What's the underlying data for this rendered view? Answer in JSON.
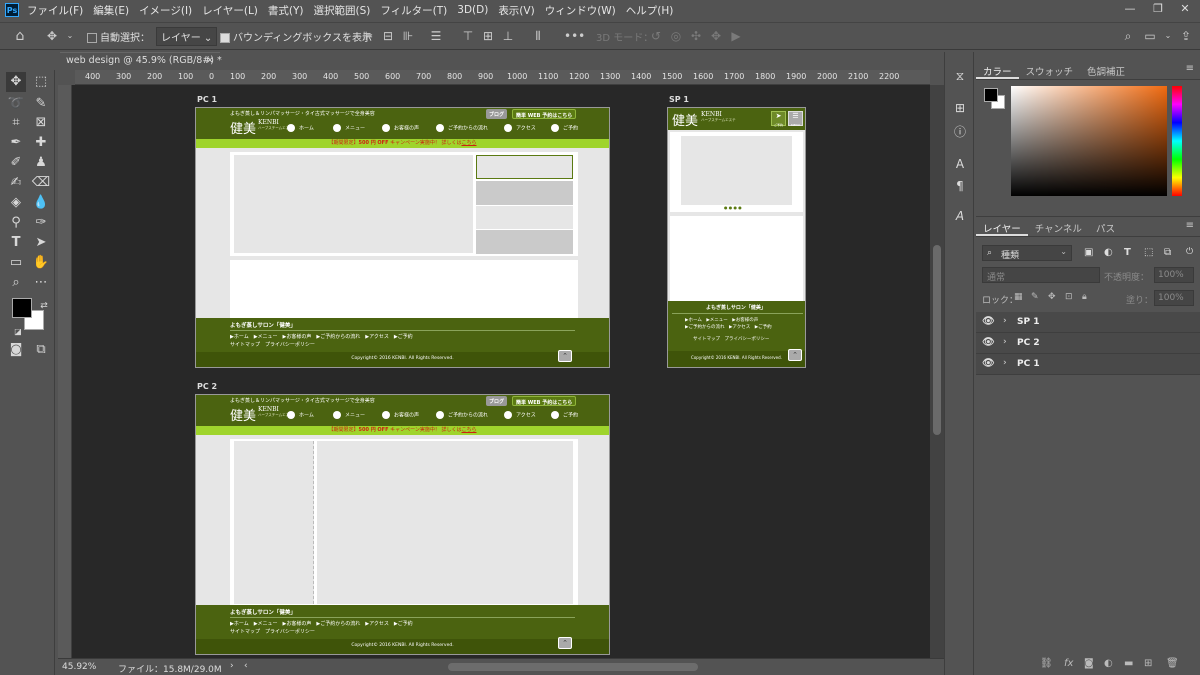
{
  "menubar": {
    "items": [
      "ファイル(F)",
      "編集(E)",
      "イメージ(I)",
      "レイヤー(L)",
      "書式(Y)",
      "選択範囲(S)",
      "フィルター(T)",
      "3D(D)",
      "表示(V)",
      "ウィンドウ(W)",
      "ヘルプ(H)"
    ],
    "ps_logo": "Ps"
  },
  "options": {
    "auto_select": "自動選択：",
    "layer_dropdown": "レイヤー",
    "bounding_box": "バウンディングボックスを表示",
    "mode3d": "3D モード："
  },
  "doc": {
    "tab_title": "web design @ 45.9% (RGB/8#) *",
    "close": "×",
    "zoom": "45.92%",
    "file_info": "ファイル：15.8M/29.0M"
  },
  "ruler": {
    "h_labels": [
      "400",
      "300",
      "200",
      "100",
      "0",
      "100",
      "200",
      "300",
      "400",
      "500",
      "600",
      "700",
      "800",
      "900",
      "1000",
      "1100",
      "1200",
      "1300",
      "1400",
      "1500",
      "1600",
      "1700",
      "1800",
      "1900",
      "2000",
      "2100",
      "2200"
    ]
  },
  "artboards": {
    "pc1_label": "PC 1",
    "pc2_label": "PC 2",
    "sp1_label": "SP 1",
    "tagline": "よもぎ蒸し＆リンパマッサージ・タイ古式マッサージで全身美容",
    "logo_jp": "健美",
    "logo_en": "KENBI",
    "logo_sub": "ハーブスチームエステ",
    "blog_btn": "ブログ",
    "reserve_btn": "簡単 WEB 予約はこちら",
    "nav": [
      "ホーム",
      "メニュー",
      "お客様の声",
      "ご予約からの流れ",
      "アクセス",
      "ご予約"
    ],
    "promo_pre": "【期間限定】",
    "promo_bold": "500 円 OFF",
    "promo_mid": "キャンペーン実施中！ 詳しくは",
    "promo_link": "こちら",
    "footer_title": "よもぎ蒸しサロン「健美」",
    "footer_nav": "▶ホーム　▶メニュー　▶お客様の声　▶ご予約からの流れ　▶アクセス　▶ご予約",
    "footer_nav_sp1": "▶ホーム　▶メニュー　▶お客様の声",
    "footer_nav_sp2": "▶ご予約からの流れ　▶アクセス　▶ご予約",
    "footer_links": "サイトマップ　プライバシーポリシー",
    "copyright": "Copyright© 2016 KENBI. All Rights Reserved.",
    "sp_btn_reserve": "ご予約",
    "sp_btn_menu": "MENU",
    "slider_dots": "● ● ● ●",
    "top_btn": "⌃"
  },
  "color_panel": {
    "tabs": [
      "カラー",
      "スウォッチ",
      "色調補正"
    ],
    "fg": "#000000",
    "bg": "#ffffff"
  },
  "layers_panel": {
    "tabs": [
      "レイヤー",
      "チャンネル",
      "パス"
    ],
    "filter_kind": "種類",
    "blend_mode": "通常",
    "opacity_label": "不透明度：",
    "opacity_val": "100%",
    "lock_label": "ロック：",
    "fill_label": "塗り：",
    "fill_val": "100%",
    "layers": [
      {
        "name": "SP 1"
      },
      {
        "name": "PC 2"
      },
      {
        "name": "PC 1"
      }
    ]
  },
  "colors": {
    "header_green": "#4b6310",
    "promo_green": "#9fd42c",
    "canvas": "#282828",
    "ui": "#535353"
  }
}
